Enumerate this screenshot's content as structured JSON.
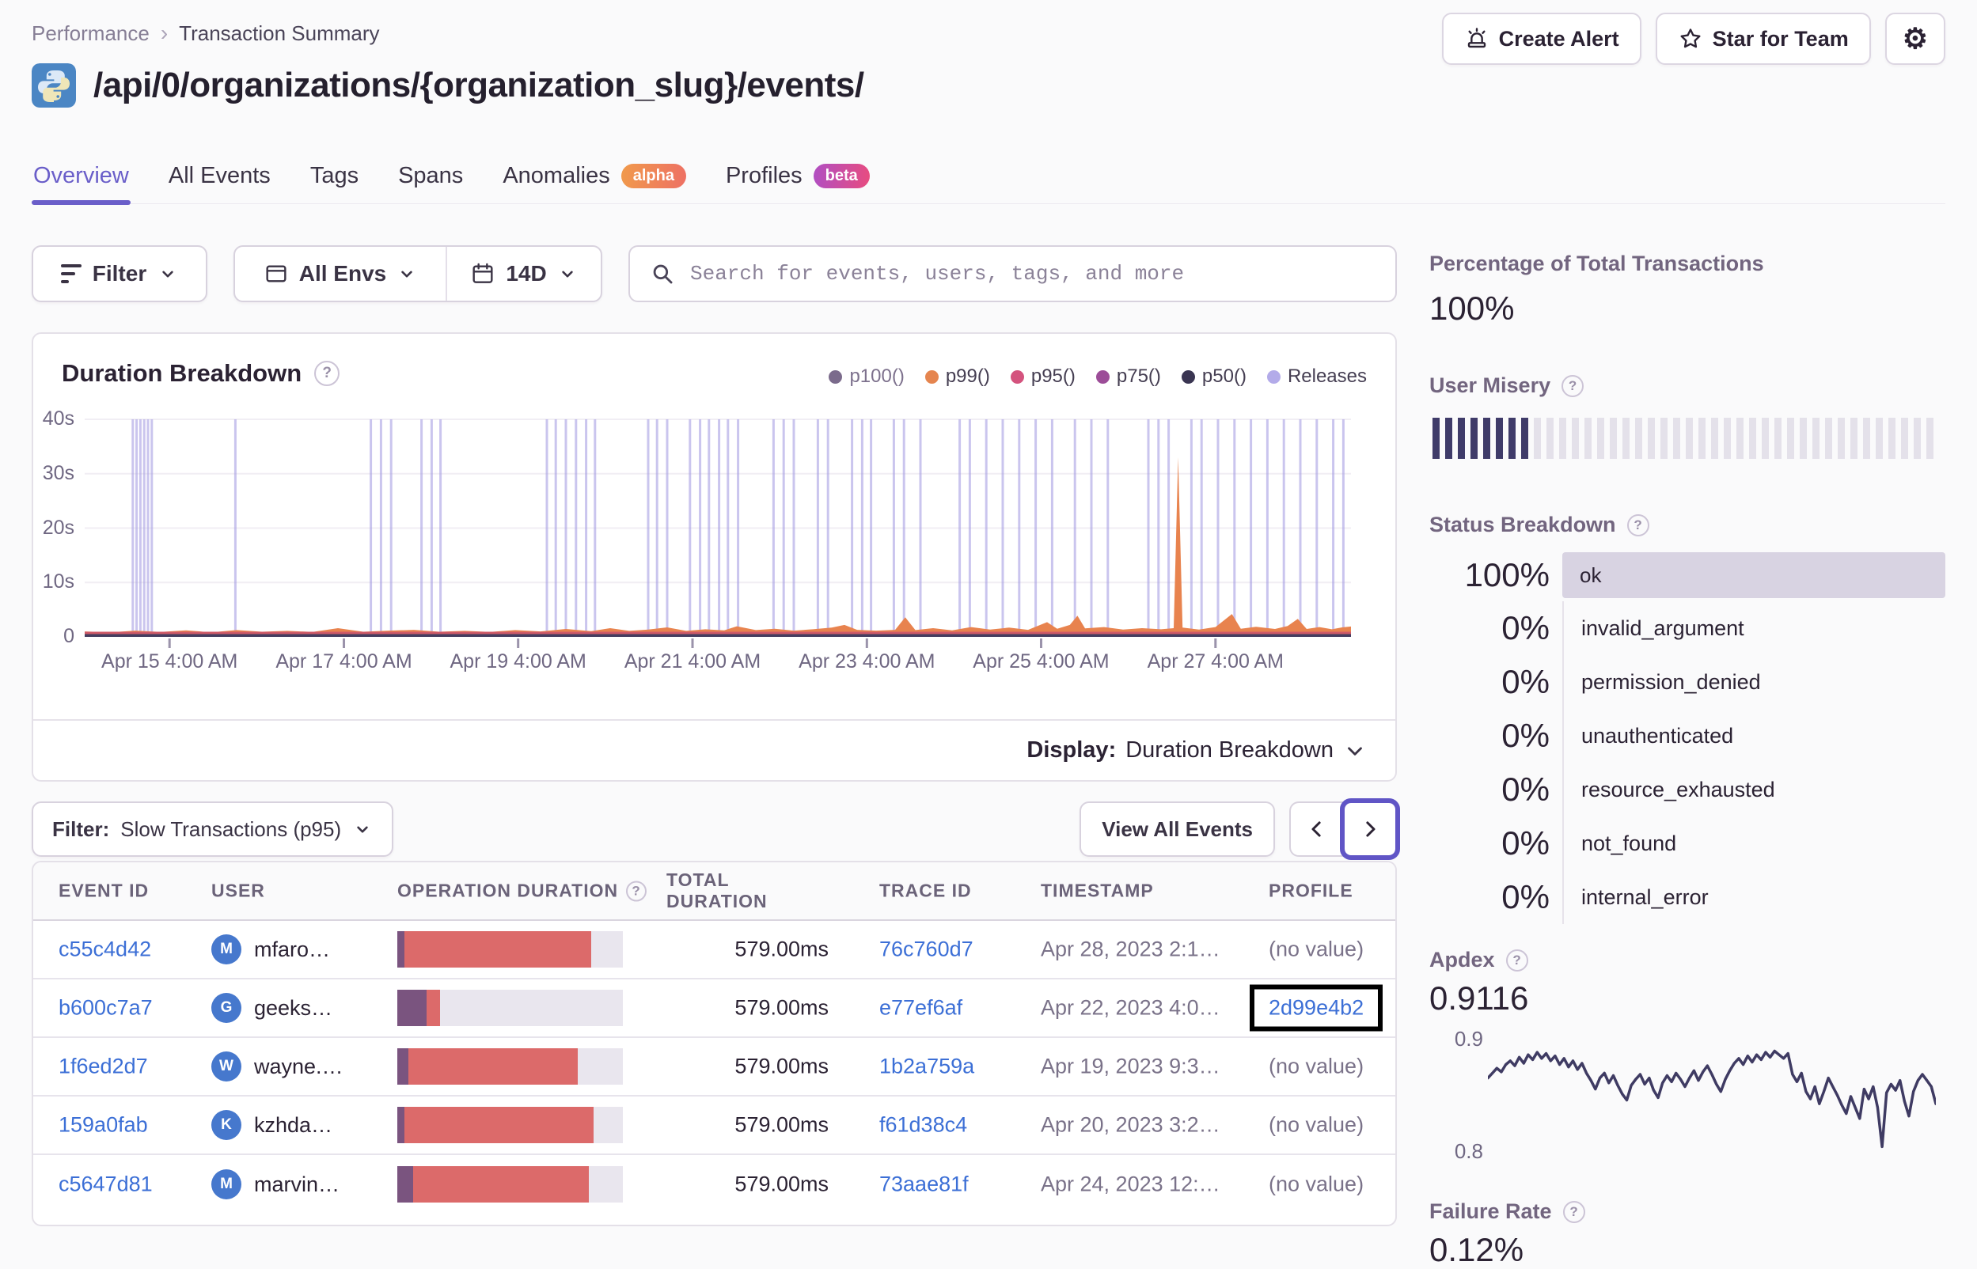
{
  "breadcrumb": {
    "parent": "Performance",
    "separator": "›",
    "current": "Transaction Summary"
  },
  "header": {
    "title": "/api/0/organizations/{organization_slug}/events/",
    "create_alert_label": "Create Alert",
    "star_label": "Star for Team"
  },
  "tabs": [
    {
      "label": "Overview",
      "active": true
    },
    {
      "label": "All Events"
    },
    {
      "label": "Tags"
    },
    {
      "label": "Spans"
    },
    {
      "label": "Anomalies",
      "badge": "alpha"
    },
    {
      "label": "Profiles",
      "badge": "beta"
    }
  ],
  "filter_bar": {
    "filter_label": "Filter",
    "env_label": "All Envs",
    "date_label": "14D",
    "search_placeholder": "Search for events, users, tags, and more"
  },
  "duration_chart": {
    "title": "Duration Breakdown",
    "legend": [
      {
        "label": "p100()",
        "color": "#7b6b8c",
        "muted": true
      },
      {
        "label": "p99()",
        "color": "#e5854f"
      },
      {
        "label": "p95()",
        "color": "#d4537e"
      },
      {
        "label": "p75()",
        "color": "#9c4d98"
      },
      {
        "label": "p50()",
        "color": "#3a3552"
      },
      {
        "label": "Releases",
        "color": "#b3abe9"
      }
    ],
    "display_label": "Display:",
    "display_value": "Duration Breakdown"
  },
  "events_section": {
    "filter_label": "Filter:",
    "filter_value": "Slow Transactions (p95)",
    "view_all_label": "View All Events",
    "columns": [
      "EVENT ID",
      "USER",
      "OPERATION DURATION",
      "TOTAL DURATION",
      "TRACE ID",
      "TIMESTAMP",
      "PROFILE"
    ],
    "rows": [
      {
        "event_id": "c55c4d42",
        "user_initial": "M",
        "user": "mfaro…",
        "bar_purple": 3,
        "bar_red": 83,
        "total": "579.00ms",
        "trace_id": "76c760d7",
        "timestamp": "Apr 28, 2023 2:1…",
        "profile": "(no value)",
        "profile_is_link": false,
        "highlighted": false
      },
      {
        "event_id": "b600c7a7",
        "user_initial": "G",
        "user": "geeks…",
        "bar_purple": 13,
        "bar_red": 6,
        "total": "579.00ms",
        "trace_id": "e77ef6af",
        "timestamp": "Apr 22, 2023 4:0…",
        "profile": "2d99e4b2",
        "profile_is_link": true,
        "highlighted": true
      },
      {
        "event_id": "1f6ed2d7",
        "user_initial": "W",
        "user": "wayne.…",
        "bar_purple": 5,
        "bar_red": 75,
        "total": "579.00ms",
        "trace_id": "1b2a759a",
        "timestamp": "Apr 19, 2023 9:3…",
        "profile": "(no value)",
        "profile_is_link": false,
        "highlighted": false
      },
      {
        "event_id": "159a0fab",
        "user_initial": "K",
        "user": "kzhda…",
        "bar_purple": 3,
        "bar_red": 84,
        "total": "579.00ms",
        "trace_id": "f61d38c4",
        "timestamp": "Apr 20, 2023 3:2…",
        "profile": "(no value)",
        "profile_is_link": false,
        "highlighted": false
      },
      {
        "event_id": "c5647d81",
        "user_initial": "M",
        "user": "marvin…",
        "bar_purple": 7,
        "bar_red": 78,
        "total": "579.00ms",
        "trace_id": "73aae81f",
        "timestamp": "Apr 24, 2023 12:…",
        "profile": "(no value)",
        "profile_is_link": false,
        "highlighted": false
      }
    ]
  },
  "sidebar": {
    "total_transactions": {
      "title": "Percentage of Total Transactions",
      "value": "100%"
    },
    "user_misery": {
      "title": "User Misery"
    },
    "status_breakdown": {
      "title": "Status Breakdown"
    },
    "apdex": {
      "title": "Apdex",
      "value": "0.9116",
      "y_top": "0.9",
      "y_bottom": "0.8"
    },
    "failure_rate": {
      "title": "Failure Rate",
      "value": "0.12%"
    }
  },
  "chart_data": [
    {
      "id": "duration_breakdown",
      "type": "area",
      "title": "Duration Breakdown",
      "ylabel": "duration",
      "ylim": [
        0,
        40
      ],
      "y_ticks": [
        "40s",
        "30s",
        "20s",
        "10s",
        "0"
      ],
      "x_ticks": [
        {
          "label": "Apr 15 4:00 AM",
          "pct": 6.7
        },
        {
          "label": "Apr 17 4:00 AM",
          "pct": 20.47
        },
        {
          "label": "Apr 19 4:00 AM",
          "pct": 34.23
        },
        {
          "label": "Apr 21 4:00 AM",
          "pct": 48.0
        },
        {
          "label": "Apr 23 4:00 AM",
          "pct": 61.77
        },
        {
          "label": "Apr 25 4:00 AM",
          "pct": 75.53
        },
        {
          "label": "Apr 27 4:00 AM",
          "pct": 89.3
        }
      ],
      "series": [
        {
          "name": "p99()",
          "unit": "seconds",
          "points": [
            [
              0,
              1.0
            ],
            [
              2,
              0.85
            ],
            [
              4,
              1.15
            ],
            [
              6,
              0.9
            ],
            [
              8,
              1.2
            ],
            [
              10,
              0.85
            ],
            [
              12,
              1.25
            ],
            [
              14,
              0.95
            ],
            [
              16,
              1.1
            ],
            [
              18,
              0.9
            ],
            [
              20,
              1.6
            ],
            [
              22,
              0.95
            ],
            [
              24,
              1.15
            ],
            [
              26,
              1.3
            ],
            [
              28,
              0.95
            ],
            [
              30,
              1.1
            ],
            [
              32,
              0.9
            ],
            [
              34,
              1.25
            ],
            [
              36,
              1.0
            ],
            [
              38,
              1.45
            ],
            [
              40,
              1.05
            ],
            [
              41.5,
              1.6
            ],
            [
              43,
              1.1
            ],
            [
              44.5,
              1.35
            ],
            [
              46,
              1.75
            ],
            [
              47.5,
              1.1
            ],
            [
              49,
              1.4
            ],
            [
              50.5,
              1.2
            ],
            [
              51.5,
              1.95
            ],
            [
              53,
              1.25
            ],
            [
              54.5,
              1.5
            ],
            [
              56,
              1.15
            ],
            [
              57.5,
              1.4
            ],
            [
              59,
              1.7
            ],
            [
              60,
              2.2
            ],
            [
              61,
              1.3
            ],
            [
              62.5,
              1.15
            ],
            [
              64,
              1.3
            ],
            [
              64.8,
              3.6
            ],
            [
              65.6,
              1.25
            ],
            [
              67,
              1.6
            ],
            [
              68.5,
              1.2
            ],
            [
              70,
              1.8
            ],
            [
              71.5,
              1.35
            ],
            [
              73,
              1.7
            ],
            [
              74.5,
              1.3
            ],
            [
              76,
              2.7
            ],
            [
              76.8,
              1.5
            ],
            [
              77.8,
              2.2
            ],
            [
              78.4,
              3.9
            ],
            [
              79,
              1.55
            ],
            [
              80.5,
              1.8
            ],
            [
              82,
              1.35
            ],
            [
              83.5,
              1.6
            ],
            [
              85,
              1.4
            ],
            [
              86,
              1.6
            ],
            [
              86.35,
              33
            ],
            [
              86.7,
              1.7
            ],
            [
              88,
              1.35
            ],
            [
              89.3,
              1.8
            ],
            [
              90.6,
              4.2
            ],
            [
              91.3,
              1.5
            ],
            [
              92.5,
              1.85
            ],
            [
              94,
              1.45
            ],
            [
              95,
              2.0
            ],
            [
              95.8,
              3.3
            ],
            [
              96.5,
              1.45
            ],
            [
              97.5,
              1.8
            ],
            [
              98.5,
              1.4
            ],
            [
              99.3,
              1.75
            ],
            [
              100,
              1.9
            ]
          ]
        }
      ],
      "releases_x_pct": [
        3.8,
        4.1,
        4.4,
        4.7,
        5.0,
        5.3,
        11.9,
        22.6,
        23.4,
        24.2,
        26.6,
        27.4,
        28.1,
        36.5,
        37.2,
        38.0,
        38.8,
        39.6,
        40.3,
        44.5,
        45.2,
        46.0,
        47.8,
        48.6,
        49.3,
        50.1,
        50.8,
        51.6,
        54.4,
        55.2,
        56.0,
        57.9,
        58.7,
        60.6,
        61.4,
        62.1,
        63.9,
        64.7,
        66.0,
        69.1,
        69.9,
        71.2,
        72.5,
        73.8,
        75.1,
        76.4,
        78.2,
        79.5,
        80.8,
        84.0,
        84.8,
        85.6,
        87.4,
        88.2,
        89.5,
        90.8,
        92.1,
        93.4,
        94.7,
        96.0,
        97.3,
        98.6,
        99.4
      ]
    },
    {
      "id": "user_misery_score",
      "type": "bar",
      "filled": 8,
      "total": 40
    },
    {
      "id": "status_breakdown",
      "type": "table",
      "rows": [
        {
          "pct": "100%",
          "label": "ok",
          "bar": true
        },
        {
          "pct": "0%",
          "label": "invalid_argument",
          "bar": false
        },
        {
          "pct": "0%",
          "label": "permission_denied",
          "bar": false
        },
        {
          "pct": "0%",
          "label": "unauthenticated",
          "bar": false
        },
        {
          "pct": "0%",
          "label": "resource_exhausted",
          "bar": false
        },
        {
          "pct": "0%",
          "label": "not_found",
          "bar": false
        },
        {
          "pct": "0%",
          "label": "internal_error",
          "bar": false
        }
      ]
    },
    {
      "id": "apdex_trend",
      "type": "line",
      "ylim": [
        0.8,
        0.9
      ],
      "values": [
        0.868,
        0.872,
        0.876,
        0.873,
        0.879,
        0.882,
        0.878,
        0.885,
        0.88,
        0.887,
        0.883,
        0.889,
        0.884,
        0.888,
        0.882,
        0.886,
        0.879,
        0.884,
        0.877,
        0.882,
        0.875,
        0.88,
        0.872,
        0.866,
        0.859,
        0.868,
        0.872,
        0.864,
        0.87,
        0.862,
        0.855,
        0.85,
        0.862,
        0.867,
        0.871,
        0.863,
        0.868,
        0.858,
        0.852,
        0.864,
        0.87,
        0.865,
        0.872,
        0.867,
        0.861,
        0.868,
        0.874,
        0.866,
        0.873,
        0.878,
        0.871,
        0.863,
        0.857,
        0.867,
        0.874,
        0.88,
        0.884,
        0.879,
        0.886,
        0.881,
        0.887,
        0.883,
        0.889,
        0.885,
        0.89,
        0.887,
        0.884,
        0.888,
        0.871,
        0.865,
        0.872,
        0.857,
        0.851,
        0.861,
        0.847,
        0.857,
        0.868,
        0.861,
        0.854,
        0.846,
        0.839,
        0.853,
        0.844,
        0.835,
        0.859,
        0.851,
        0.861,
        0.844,
        0.812,
        0.856,
        0.863,
        0.858,
        0.866,
        0.849,
        0.837,
        0.857,
        0.866,
        0.871,
        0.866,
        0.861,
        0.847
      ]
    }
  ]
}
